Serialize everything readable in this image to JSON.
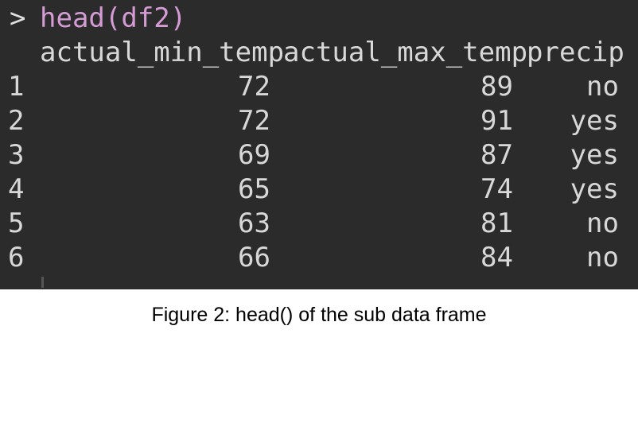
{
  "console": {
    "prompt_symbol": ">",
    "command": "head(df2)",
    "columns": [
      "actual_min_temp",
      "actual_max_temp",
      "precip"
    ],
    "rows": [
      {
        "index": "1",
        "actual_min_temp": "72",
        "actual_max_temp": "89",
        "precip": "no"
      },
      {
        "index": "2",
        "actual_min_temp": "72",
        "actual_max_temp": "91",
        "precip": "yes"
      },
      {
        "index": "3",
        "actual_min_temp": "69",
        "actual_max_temp": "87",
        "precip": "yes"
      },
      {
        "index": "4",
        "actual_min_temp": "65",
        "actual_max_temp": "74",
        "precip": "yes"
      },
      {
        "index": "5",
        "actual_min_temp": "63",
        "actual_max_temp": "81",
        "precip": "no"
      },
      {
        "index": "6",
        "actual_min_temp": "66",
        "actual_max_temp": "84",
        "precip": "no"
      }
    ]
  },
  "caption": "Figure 2: head() of the sub data frame",
  "colors": {
    "background": "#2b2b2b",
    "text": "#d8d8d8",
    "command": "#d49bd4"
  }
}
